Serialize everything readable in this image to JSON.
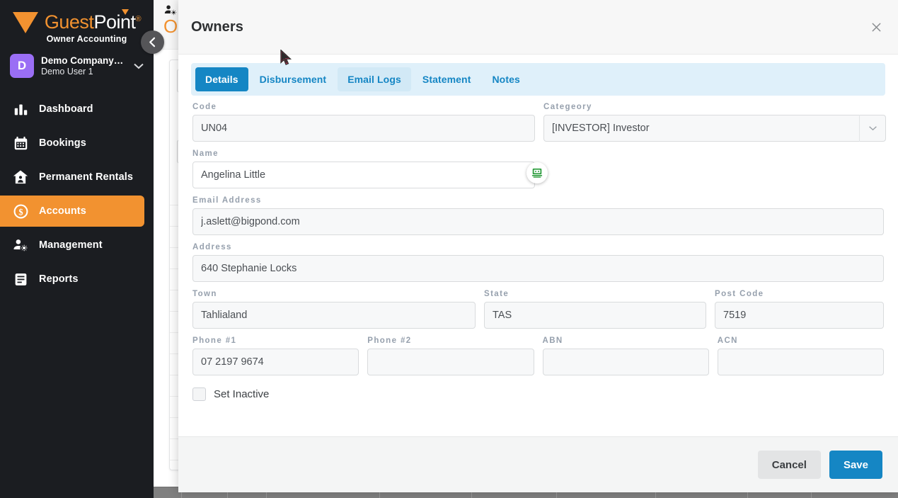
{
  "sidebar": {
    "brand": {
      "guest": "Guest",
      "point": "Point",
      "registered": "®",
      "subtitle": "Owner Accounting"
    },
    "company": {
      "avatar_letter": "D",
      "name": "Demo Company…",
      "user": "Demo User 1",
      "caret": "⌄"
    },
    "items": [
      {
        "label": "Dashboard",
        "icon": "bar-chart-icon",
        "active": false
      },
      {
        "label": "Bookings",
        "icon": "calendar-icon",
        "active": false
      },
      {
        "label": "Permanent Rentals",
        "icon": "house-person-icon",
        "active": false
      },
      {
        "label": "Accounts",
        "icon": "dollar-circle-icon",
        "active": true
      },
      {
        "label": "Management",
        "icon": "people-gear-icon",
        "active": false
      },
      {
        "label": "Reports",
        "icon": "document-list-icon",
        "active": false
      }
    ],
    "collapse_icon": "‹",
    "active_color": "#f29230",
    "background": "#1b1d21"
  },
  "background_page": {
    "title": "O",
    "crumb_icon": "people-gear-icon"
  },
  "modal": {
    "title": "Owners",
    "close_icon": "×",
    "tabs": [
      {
        "label": "Details",
        "state": "active"
      },
      {
        "label": "Disbursement",
        "state": "normal"
      },
      {
        "label": "Email Logs",
        "state": "hover"
      },
      {
        "label": "Statement",
        "state": "normal"
      },
      {
        "label": "Notes",
        "state": "normal"
      }
    ],
    "fields": {
      "code": {
        "label": "Code",
        "value": "UN04",
        "placeholder": ""
      },
      "category": {
        "label": "Categeory",
        "value": "[INVESTOR] Investor",
        "caret": "⌄"
      },
      "name": {
        "label": "Name",
        "value": "Angelina Little",
        "placeholder": ""
      },
      "email": {
        "label": "Email Address",
        "value": "j.aslett@bigpond.com",
        "placeholder": ""
      },
      "address": {
        "label": "Address",
        "value": "640 Stephanie Locks",
        "placeholder": ""
      },
      "town": {
        "label": "Town",
        "value": "Tahlialand",
        "placeholder": ""
      },
      "state": {
        "label": "State",
        "value": "TAS",
        "placeholder": ""
      },
      "post_code": {
        "label": "Post Code",
        "value": "7519",
        "placeholder": ""
      },
      "phone1": {
        "label": "Phone #1",
        "value": "07 2197 9674",
        "placeholder": ""
      },
      "phone2": {
        "label": "Phone #2",
        "value": "",
        "placeholder": ""
      },
      "abn": {
        "label": "ABN",
        "value": "",
        "placeholder": ""
      },
      "acn": {
        "label": "ACN",
        "value": "",
        "placeholder": ""
      }
    },
    "set_inactive": {
      "label": "Set Inactive",
      "checked": false
    },
    "footer": {
      "cancel_label": "Cancel",
      "save_label": "Save"
    },
    "accent_color": "#1586c4",
    "tabbar_color": "#dff0fa"
  },
  "overlays": {
    "autofill_badge": {
      "icon": "green-robot-autofill-icon",
      "color": "#2e9e3f"
    },
    "cursor": {
      "icon": "mouse-pointer-icon"
    }
  }
}
